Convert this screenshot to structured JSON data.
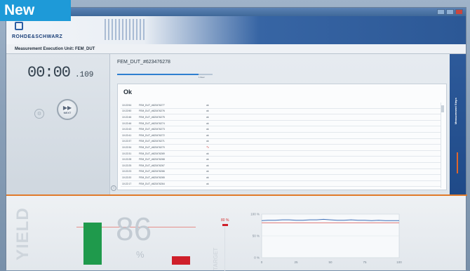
{
  "badge": "New",
  "header": {
    "brand": "ROHDE&SCHWARZ"
  },
  "subheader": {
    "text": "Measurement Execution Unit: FEM_DUT"
  },
  "timer": {
    "main": "00:00",
    "ms": ".109"
  },
  "next_button": {
    "label": "NEXT",
    "arrows": "▶▶"
  },
  "dut": {
    "title": "FEM_DUT_#623476278",
    "progress_label": "1.9sec"
  },
  "log": {
    "status": "Ok",
    "rows": [
      {
        "time": "10:22:54",
        "name": "FEM_DUT_#623476277",
        "result": "ok",
        "error": false
      },
      {
        "time": "10:22:50",
        "name": "FEM_DUT_#623476276",
        "result": "ok",
        "error": false
      },
      {
        "time": "10:22:46",
        "name": "FEM_DUT_#623476275",
        "result": "ok",
        "error": false
      },
      {
        "time": "10:22:46",
        "name": "FEM_DUT_#623476274",
        "result": "ok",
        "error": false
      },
      {
        "time": "10:22:43",
        "name": "FEM_DUT_#623476273",
        "result": "ok",
        "error": false
      },
      {
        "time": "10:22:41",
        "name": "FEM_DUT_#623476272",
        "result": "ok",
        "error": false
      },
      {
        "time": "10:22:37",
        "name": "FEM_DUT_#623476271",
        "result": "ok",
        "error": false
      },
      {
        "time": "10:22:34",
        "name": "FEM_DUT_#623476270",
        "result": "∿",
        "error": true
      },
      {
        "time": "10:22:31",
        "name": "FEM_DUT_#623476269",
        "result": "ok",
        "error": false
      },
      {
        "time": "10:22:28",
        "name": "FEM_DUT_#623476268",
        "result": "ok",
        "error": false
      },
      {
        "time": "10:22:25",
        "name": "FEM_DUT_#623476267",
        "result": "ok",
        "error": false
      },
      {
        "time": "10:22:23",
        "name": "FEM_DUT_#623476266",
        "result": "ok",
        "error": false
      },
      {
        "time": "10:22:20",
        "name": "FEM_DUT_#623476265",
        "result": "ok",
        "error": false
      },
      {
        "time": "10:22:17",
        "name": "FEM_DUT_#623476264",
        "result": "ok",
        "error": false
      }
    ]
  },
  "side_tab": {
    "label": "Measurement Steps"
  },
  "yield": {
    "label": "YIELD",
    "value": "86",
    "unit": "%",
    "pass_fraction": 0.86,
    "fail_fraction": 0.14,
    "target_label": "TARGET",
    "target_value": "80 %"
  },
  "chart_data": {
    "type": "line",
    "x": [
      0,
      5,
      10,
      15,
      20,
      25,
      30,
      35,
      40,
      45,
      50,
      55,
      60,
      65,
      70,
      75,
      80,
      85,
      90,
      95,
      100
    ],
    "series": [
      {
        "values": [
          85,
          86,
          86,
          87,
          87,
          86,
          86,
          87,
          87,
          88,
          87,
          86,
          86,
          87,
          86,
          86,
          85,
          86,
          85,
          85,
          85
        ],
        "color": "#3d6fb8"
      },
      {
        "values": [
          80,
          80,
          80,
          80,
          80,
          80,
          80,
          80,
          80,
          80,
          80,
          80,
          80,
          80,
          80,
          80,
          80,
          80,
          80,
          80,
          80
        ],
        "color": "#e07a7a"
      }
    ],
    "x_ticks": [
      "0",
      "25",
      "50",
      "75",
      "100"
    ],
    "y_ticks": [
      "100 %",
      "50 %",
      "0 %"
    ],
    "ylim": [
      0,
      100
    ],
    "xlim": [
      0,
      100
    ]
  }
}
